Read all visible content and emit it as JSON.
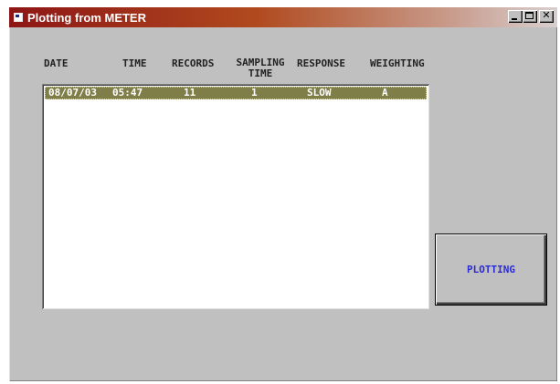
{
  "window": {
    "title": "Plotting from METER",
    "controls": [
      "minimize-icon",
      "maximize-icon",
      "close-icon"
    ]
  },
  "table": {
    "headers": {
      "date": "DATE",
      "time": "TIME",
      "records": "RECORDS",
      "sampling_line1": "SAMPLING",
      "sampling_line2": "TIME",
      "response": "RESPONSE",
      "weighting": "WEIGHTING"
    },
    "rows": [
      {
        "date": "08/07/03",
        "time": "05:47",
        "records": "11",
        "sampling_time": "1",
        "response": "SLOW",
        "weighting": "A",
        "selected": true
      }
    ]
  },
  "buttons": {
    "plotting_label": "PLOTTING"
  },
  "colors": {
    "title_gradient_start": "#8d1616",
    "window_bg": "#c0c0c0",
    "selected_row": "#7f7d48",
    "plotting_text": "#2b2bd6"
  }
}
